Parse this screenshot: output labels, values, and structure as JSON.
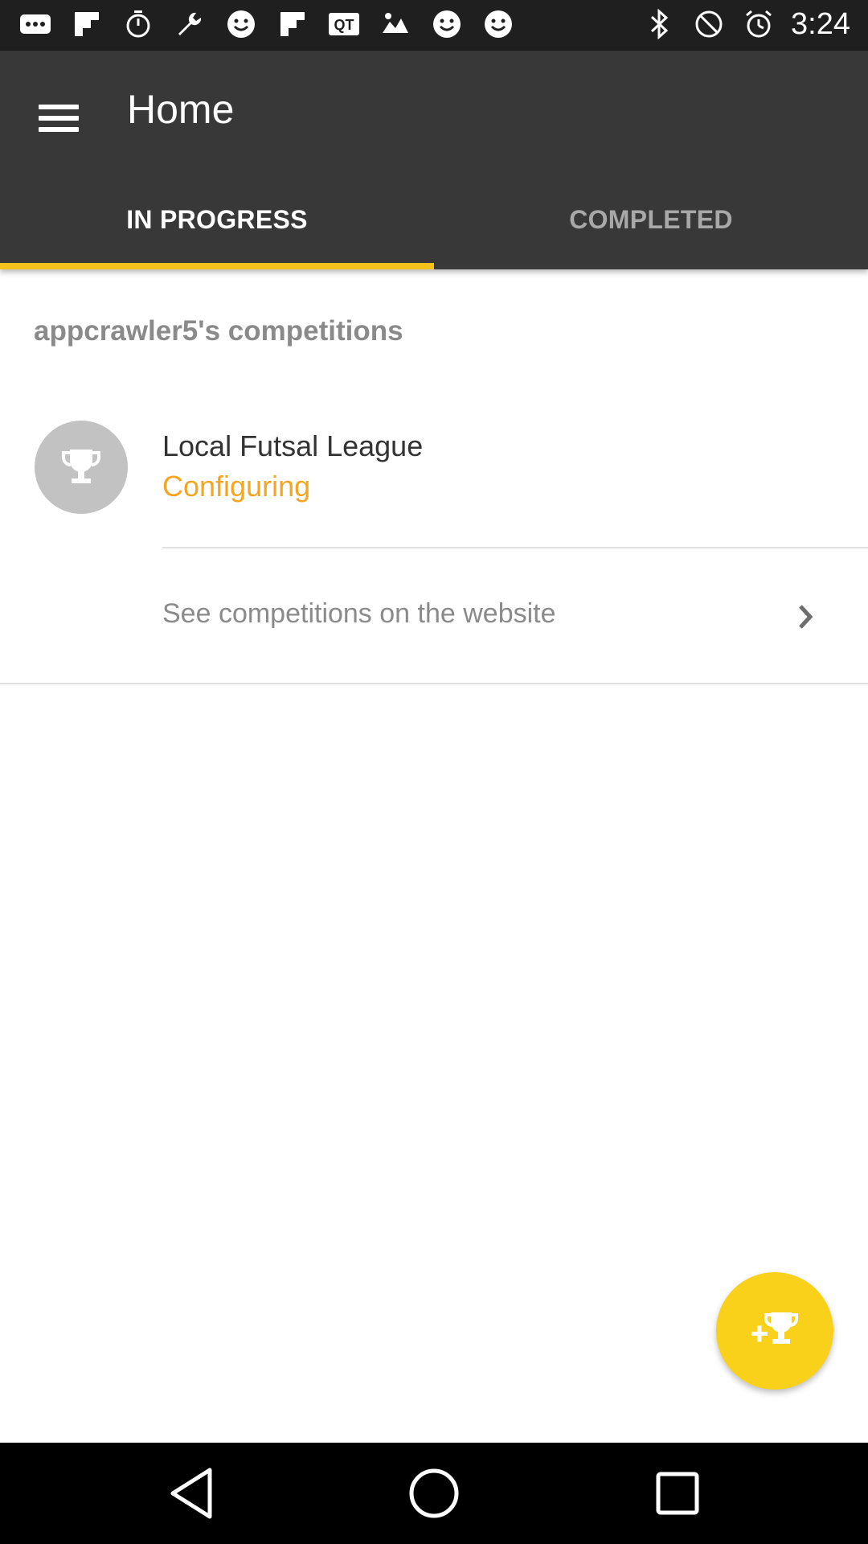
{
  "status_bar": {
    "time": "3:24",
    "notification_icons": [
      "more-icon",
      "flipboard-icon",
      "timer-icon",
      "wrench-icon",
      "smiley-icon",
      "flipboard-icon",
      "qt-icon",
      "image-icon",
      "smiley-icon",
      "smiley-icon"
    ],
    "system_icons": [
      "bluetooth-icon",
      "do-not-disturb-icon",
      "alarm-icon"
    ]
  },
  "app_bar": {
    "title": "Home",
    "menu_icon": "hamburger-menu-icon"
  },
  "tabs": [
    {
      "label": "IN PROGRESS",
      "active": true
    },
    {
      "label": "COMPLETED",
      "active": false
    }
  ],
  "section": {
    "title": "appcrawler5's competitions"
  },
  "competitions": [
    {
      "name": "Local Futsal League",
      "status": "Configuring",
      "icon": "trophy-icon"
    }
  ],
  "website_link": {
    "label": "See competitions on the website",
    "icon": "chevron-right-icon"
  },
  "fab": {
    "icon": "add-trophy-icon"
  },
  "colors": {
    "status_bar": "#1f1f1f",
    "app_bar": "#383838",
    "tab_indicator": "#f5c21b",
    "status_text": "#f4a623",
    "fab": "#f9d11b",
    "nav_bar": "#000000"
  }
}
